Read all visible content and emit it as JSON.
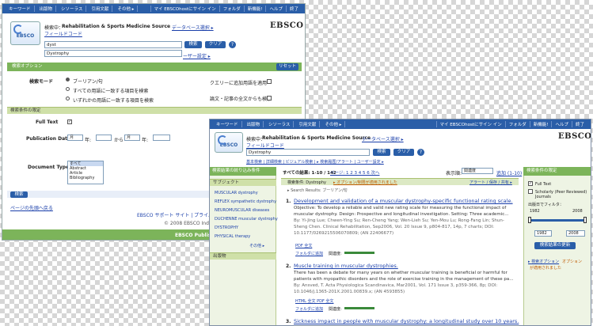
{
  "back": {
    "top_nav": [
      "キーワード",
      "出版物",
      "シソーラス",
      "引用文献",
      "その他 ▸"
    ],
    "top_right": [
      "マイ EBSCOhostにサイン イン",
      "フォルダ",
      "新機能!",
      "ヘルプ",
      "終了"
    ],
    "searching_label": "検索中：",
    "database": "Rehabilitation & Sports Medicine Source",
    "db_select": "データベース選択 ▸",
    "field_code": "フィールドコード",
    "query1": "dyst",
    "query2": "Dystrophy",
    "search_btn": "検索",
    "clear_btn": "クリア",
    "settings_link": "ーザー設定 ▸",
    "options_bar": "検索オプション",
    "reset_btn": "リセット",
    "mode_label": "検索モード",
    "modes": [
      "ブーリアン/句",
      "すべての用語に一致する項目を検索",
      "いずれかの用語に一致する項目を検索"
    ],
    "query_add_label": "クエリーに追加用語を適用",
    "fulltext_search_label": "論文・記事の全文からも検索",
    "limit_bar": "検索条件の限定",
    "full_text_label": "Full Text",
    "pubdate_label": "Publication Date",
    "month_label": "月",
    "year_label": "年:",
    "from_label": "から",
    "doctype_label": "Document Type",
    "doctypes": [
      "すべて",
      "Abstract",
      "Article",
      "Bibliography"
    ],
    "search_btn2": "検索",
    "page_top": "ページの先頭へ戻る",
    "support": "EBSCO サポート サイト | プライバシ",
    "copyright": "© 2008 EBSCO Indust",
    "publishing": "EBSCO Publis",
    "ebsco_logo": "EBSCO"
  },
  "front": {
    "top_nav": [
      "キーワード",
      "出版物",
      "シソーラス",
      "引用文献",
      "その他 ▸"
    ],
    "top_right": [
      "マイ EBSCOhostにサイン イン",
      "フォルダ",
      "新機能!",
      "ヘルプ",
      "終了"
    ],
    "searching_label": "検索中：",
    "database": "Rehabilitation & Sports Medicine Source",
    "db_select": "データベース選択 ▸",
    "field_code": "フィールドコード",
    "query": "Dystrophy",
    "search_btn": "検索",
    "clear_btn": "クリア",
    "sub_links": "基本検索 | 詳細検索 | ビジュアル検索 | ▸ 検索履歴/アラート | ユーザー設定 ▸",
    "narrow_header": "検索結果の絞り込み条件",
    "subject_header": "サブジェクト",
    "subjects": [
      "MUSCULAR dystrophy",
      "REFLEX sympathetic dystrophy",
      "NEUROMUSCULAR diseases",
      "DUCHENNE muscular dystrophy",
      "DYSTROPHY",
      "PHYSICAL therapy"
    ],
    "more": "その他 ▸",
    "publication_header": "出版物",
    "result_count": "すべての結果: 1-10 / 142",
    "pages": "ページ: 1 2 3 4 5 6 次へ",
    "sort_label": "表示順:",
    "sort_value": "関連度",
    "add_label": "追加 (1-10)",
    "search_bar_label": "検索条件: Dystrophy",
    "search_bar_link": "▸ オプション/制限が適用されました",
    "alert_link": "アラート / 保存 / 共有 ▸",
    "sub_result": "▸ Search Results: ブーリアン/句",
    "results": [
      {
        "num": "1.",
        "title": "Development and validation of a muscular dystrophy-specific functional rating scale.",
        "body": "Objective: To develop a reliable and valid new rating scale for measuring the functional impact of muscular dystrophy. Design: Prospective and longitudinal investigation. Setting: Three academic...",
        "by": "By: Yi-Jing Lue; Chwen-Ying Su; Ren-Cheng Yang; Wen-Lieh Su; Yen-Mou Lu; Rong-Fang Lin; Shun-Sheng Chen. Clinical Rehabilitation, Sep2006, Vol. 20 Issue 9, p804-817, 14p, 7 charts; DOI: 10.1177/0269215506070809; (AN 22406677)",
        "links": "PDF 全文",
        "links2": "フォルダに追加",
        "rel_label": "関連度:"
      },
      {
        "num": "2.",
        "title": "Muscle training in muscular dystrophies.",
        "body": "There has been a debate for many years on whether muscular training is beneficial or harmful for patients with myopathic disorders and the role of exercise training in the management of these pa...",
        "by": "By: Ansved, T. Acta Physiologica Scandinavica, Mar2001, Vol. 171 Issue 3, p359-366, 8p; DOI: 10.1046/j.1365-201X.2001.00839.x; (AN 4593855)",
        "links": "HTML 全文  PDF 全文",
        "links2": "フォルダに追加",
        "rel_label": "関連度:"
      },
      {
        "num": "3.",
        "title": "Sickness impact in people with muscular dystrophy: a longitudinal study over 10 years.",
        "body": "",
        "by": "",
        "links": "",
        "links2": "",
        "rel_label": ""
      }
    ],
    "limit_header": "検索条件の限定",
    "limit_full_text": "Full Text",
    "limit_scholarly": "Scholarly (Peer Reviewed) Journals",
    "limit_pubdate": "出版日でフィルタ：",
    "limit_year_from": "1982",
    "limit_year_to": "2008",
    "update_btn": "検索結果の更新",
    "options_link": "▸ 検索オプション",
    "options_link2": "オプション",
    "options_applied": "が適用されました",
    "ebsco_logo": "EBSCO"
  },
  "colors": {
    "nav": "#2a5ea8",
    "green": "#7cb45a",
    "limitbar": "#cfe0a8"
  }
}
